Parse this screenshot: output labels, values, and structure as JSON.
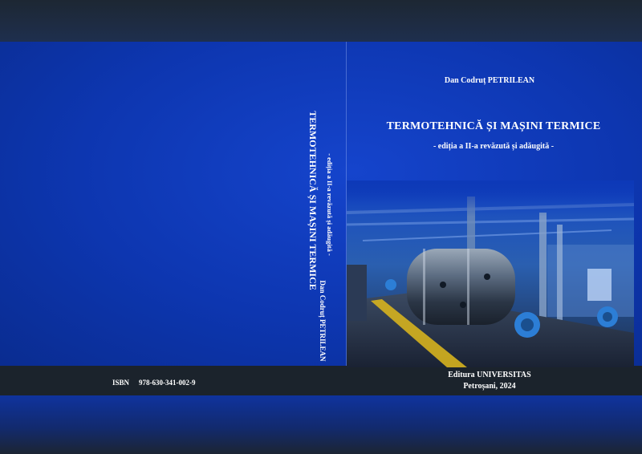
{
  "front": {
    "author": "Dan Codruț PETRILEAN",
    "title": "TERMOTEHNICĂ ȘI MAȘINI TERMICE",
    "subtitle": "- ediția a II-a revăzută și adăugită -",
    "publisher": "Editura UNIVERSITAS",
    "place_year": "Petroșani, 2024",
    "image": "industrial-boiler-room-photo"
  },
  "spine": {
    "title": "TERMOTEHNICĂ ȘI MAȘINI TERMICE",
    "subtitle": "- ediția a II-a revăzută și adăugită -",
    "author": "Dan Codruț PETRILEAN"
  },
  "back": {
    "isbn_label": "ISBN",
    "isbn_value": "978-630-341-002-9"
  },
  "colors": {
    "cover_blue": "#0d39b8",
    "band_dark": "#1b232c",
    "text": "#ffffff"
  }
}
